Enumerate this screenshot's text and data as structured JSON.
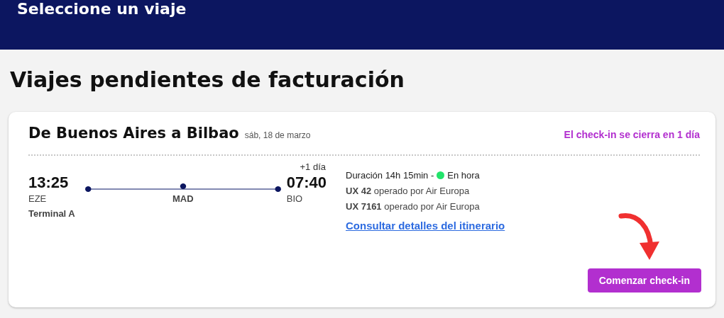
{
  "header": {
    "title": "Seleccione un viaje"
  },
  "heading": "Viajes pendientes de facturación",
  "trip": {
    "route": "De Buenos Aires a Bilbao",
    "date": "sáb, 18 de marzo",
    "closing_notice": "El check-in se cierra en 1 día",
    "departure": {
      "time": "13:25",
      "airport": "EZE",
      "terminal": "Terminal A"
    },
    "stopover": {
      "airport": "MAD"
    },
    "arrival": {
      "time": "07:40",
      "airport": "BIO",
      "day_offset": "+1 día"
    },
    "duration": "Duración 14h 15min -",
    "status": {
      "label": "En hora",
      "color": "#22e36a"
    },
    "flights": [
      "**UX 42** operado por Air Europa",
      "**UX 7161** operado por Air Europa"
    ],
    "details_link": "Consultar detalles del itinerario",
    "button": "Comenzar check-in"
  }
}
